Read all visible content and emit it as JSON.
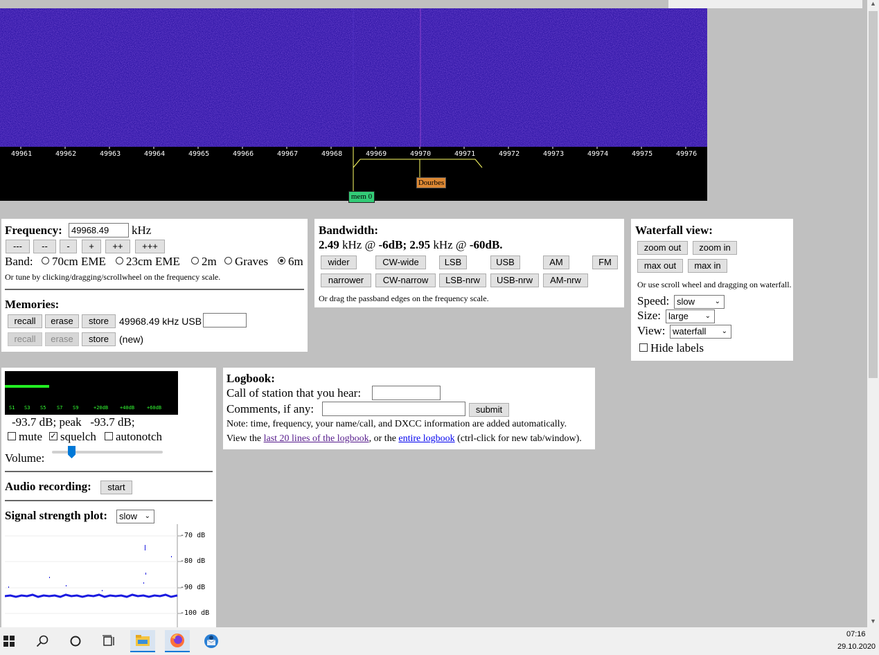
{
  "waterfall": {
    "freq_ticks": [
      "49961",
      "49962",
      "49963",
      "49964",
      "49965",
      "49966",
      "49967",
      "49968",
      "49969",
      "49970",
      "49971",
      "49972",
      "49973",
      "49974",
      "49975",
      "49976"
    ],
    "marker_dourbes": "Dourbes",
    "marker_mem": "mem 0",
    "colors": {
      "bg": "#3a1ab0",
      "scale_bg": "#000000",
      "passband": "#ffff66",
      "mem_marker": "#33cc77",
      "dourbes_marker": "#dd8833"
    }
  },
  "frequency": {
    "label": "Frequency:",
    "value": "49968.49",
    "unit": "kHz",
    "buttons": [
      "---",
      "--",
      "-",
      "+",
      "++",
      "+++"
    ],
    "band_label": "Band:",
    "bands": [
      {
        "label": "70cm EME",
        "selected": false
      },
      {
        "label": "23cm EME",
        "selected": false
      },
      {
        "label": "2m",
        "selected": false
      },
      {
        "label": "Graves",
        "selected": false
      },
      {
        "label": "6m",
        "selected": true
      }
    ],
    "hint": "Or tune by clicking/dragging/scrollwheel on the frequency scale."
  },
  "memories": {
    "title": "Memories:",
    "row1": {
      "recall": "recall",
      "erase": "erase",
      "store": "store",
      "info": "49968.49 kHz USB",
      "name": ""
    },
    "row2": {
      "recall": "recall",
      "erase": "erase",
      "store": "store",
      "info": "(new)"
    }
  },
  "bandwidth": {
    "title": "Bandwidth:",
    "val1": "2.49",
    "txt1": " kHz @ ",
    "db1": "-6dB; ",
    "val2": "2.95",
    "txt2": " kHz @ ",
    "db2": "-60dB.",
    "row1": [
      "wider",
      "CW-wide",
      "LSB",
      "USB",
      "AM",
      "FM"
    ],
    "row2": [
      "narrower",
      "CW-narrow",
      "LSB-nrw",
      "USB-nrw",
      "AM-nrw"
    ],
    "hint": "Or drag the passband edges on the frequency scale."
  },
  "waterfall_view": {
    "title": "Waterfall view:",
    "zoom_out": "zoom out",
    "zoom_in": "zoom in",
    "max_out": "max out",
    "max_in": "max in",
    "hint": "Or use scroll wheel and dragging on waterfall.",
    "speed_label": "Speed:",
    "speed_value": "slow",
    "size_label": "Size:",
    "size_value": "large",
    "view_label": "View:",
    "view_value": "waterfall",
    "hide_labels": "Hide labels"
  },
  "audio": {
    "smeter_labels": [
      "S1",
      "S3",
      "S5",
      "S7",
      "S9",
      "+20dB",
      "+40dB",
      "+60dB"
    ],
    "smeter_level": 0.26,
    "level_text": "-93.7 dB; peak   -93.7 dB;",
    "mute": "mute",
    "squelch": "squelch",
    "autonotch": "autonotch",
    "mute_checked": false,
    "squelch_checked": true,
    "autonotch_checked": false,
    "volume_label": "Volume:",
    "volume_level": 0.14,
    "recording_label": "Audio recording:",
    "recording_button": "start",
    "plot_label": "Signal strength plot:",
    "plot_speed": "slow",
    "plot_db_labels": [
      "-70 dB",
      "-80 dB",
      "-90 dB",
      "-100 dB"
    ]
  },
  "logbook": {
    "title": "Logbook:",
    "call_label": "Call of station that you hear:",
    "comments_label": "Comments, if any:",
    "submit": "submit",
    "note": "Note: time, frequency, your name/call, and DXCC information are added automatically.",
    "view_prefix": "View the ",
    "link1": "last 20 lines of the logbook",
    "mid": ", or the ",
    "link2": "entire logbook",
    "suffix": " (ctrl-click for new tab/window)."
  },
  "taskbar": {
    "time": "07:16",
    "date": "29.10.2020",
    "icons": [
      "windows-start-icon",
      "search-icon",
      "cortana-icon",
      "task-view-icon",
      "file-explorer-icon",
      "firefox-icon",
      "thunderbird-icon"
    ]
  }
}
